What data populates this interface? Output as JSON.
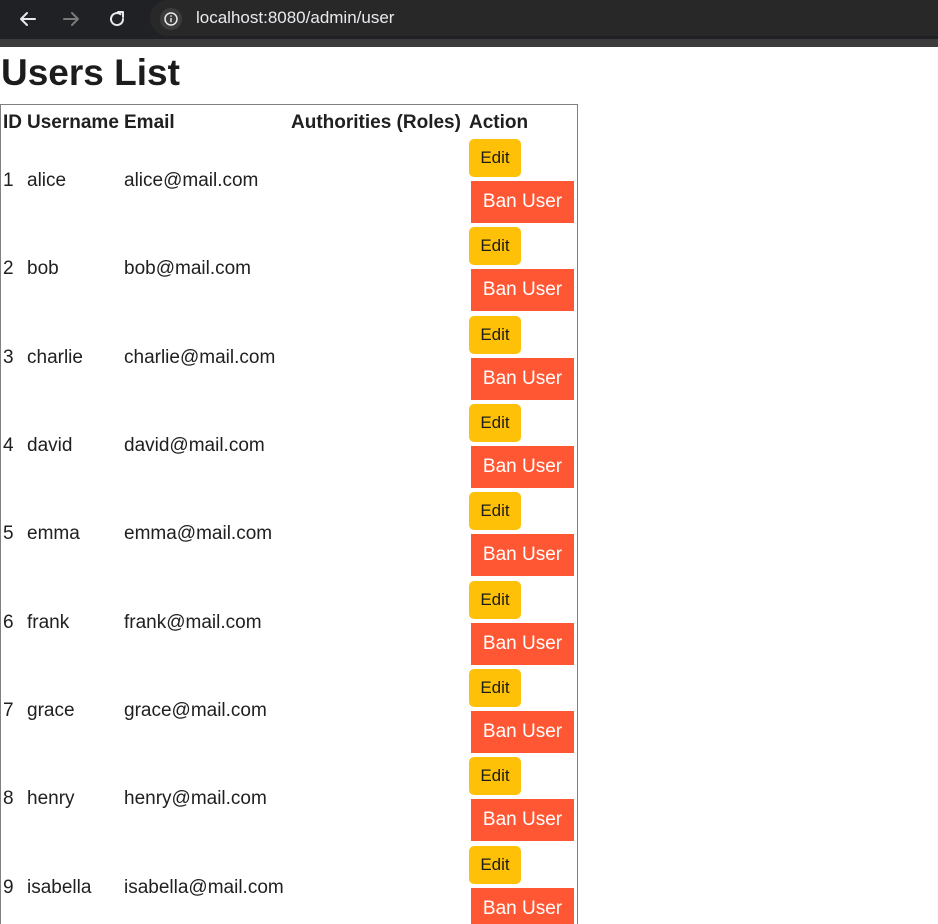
{
  "browser": {
    "url": "localhost:8080/admin/user"
  },
  "page": {
    "title": "Users List"
  },
  "table": {
    "headers": {
      "id": "ID",
      "username": "Username",
      "email": "Email",
      "roles": "Authorities (Roles)",
      "action": "Action"
    },
    "edit_label": "Edit",
    "ban_label": "Ban User",
    "rows": [
      {
        "id": "1",
        "username": "alice",
        "email": "alice@mail.com",
        "roles": ""
      },
      {
        "id": "2",
        "username": "bob",
        "email": "bob@mail.com",
        "roles": ""
      },
      {
        "id": "3",
        "username": "charlie",
        "email": "charlie@mail.com",
        "roles": ""
      },
      {
        "id": "4",
        "username": "david",
        "email": "david@mail.com",
        "roles": ""
      },
      {
        "id": "5",
        "username": "emma",
        "email": "emma@mail.com",
        "roles": ""
      },
      {
        "id": "6",
        "username": "frank",
        "email": "frank@mail.com",
        "roles": ""
      },
      {
        "id": "7",
        "username": "grace",
        "email": "grace@mail.com",
        "roles": ""
      },
      {
        "id": "8",
        "username": "henry",
        "email": "henry@mail.com",
        "roles": ""
      },
      {
        "id": "9",
        "username": "isabella",
        "email": "isabella@mail.com",
        "roles": ""
      }
    ]
  },
  "colors": {
    "edit_button": "#ffc107",
    "ban_button": "#ff5733",
    "browser_bar": "#202124"
  },
  "icons": {
    "back": "arrow-left-icon",
    "forward": "arrow-right-icon",
    "reload": "reload-icon",
    "site_info": "info-icon"
  }
}
